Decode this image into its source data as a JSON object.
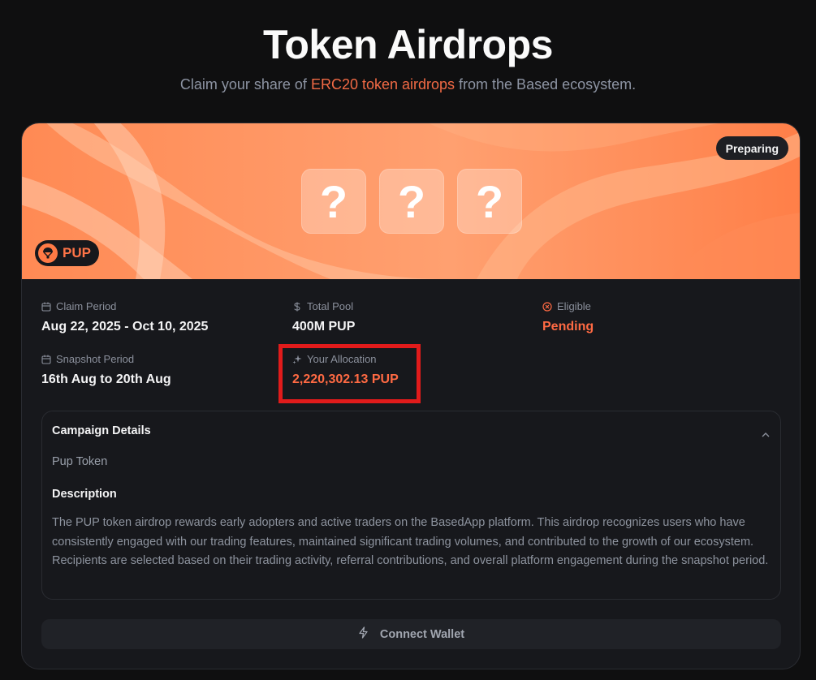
{
  "header": {
    "title": "Token Airdrops",
    "subtitle_prefix": "Claim your share of ",
    "subtitle_highlight": "ERC20 token airdrops",
    "subtitle_suffix": " from the Based ecosystem."
  },
  "campaign": {
    "status": "Preparing",
    "token_symbol": "PUP",
    "mystery_symbol": "?",
    "stats": {
      "claim_period": {
        "label": "Claim Period",
        "value": "Aug 22, 2025 - Oct 10, 2025",
        "icon": "calendar-icon"
      },
      "total_pool": {
        "label": "Total Pool",
        "value": "400M PUP",
        "icon": "dollar-icon"
      },
      "eligible": {
        "label": "Eligible",
        "value": "Pending",
        "icon": "x-circle-icon"
      },
      "snapshot_period": {
        "label": "Snapshot Period",
        "value": "16th Aug to 20th Aug",
        "icon": "calendar-icon"
      },
      "allocation": {
        "label": "Your Allocation",
        "value": "2,220,302.13 PUP",
        "icon": "sparkles-icon"
      }
    },
    "details": {
      "title": "Campaign Details",
      "name": "Pup Token",
      "description_title": "Description",
      "description": "The PUP token airdrop rewards early adopters and active traders on the BasedApp platform. This airdrop recognizes users who have consistently engaged with our trading features, maintained significant trading volumes, and contributed to the growth of our ecosystem. Recipients are selected based on their trading activity, referral contributions, and overall platform engagement during the snapshot period."
    },
    "connect_label": "Connect Wallet"
  },
  "colors": {
    "accent": "#ff6a43",
    "background": "#0f0f10",
    "card": "#17181c",
    "highlight_box": "#e11b1b"
  }
}
